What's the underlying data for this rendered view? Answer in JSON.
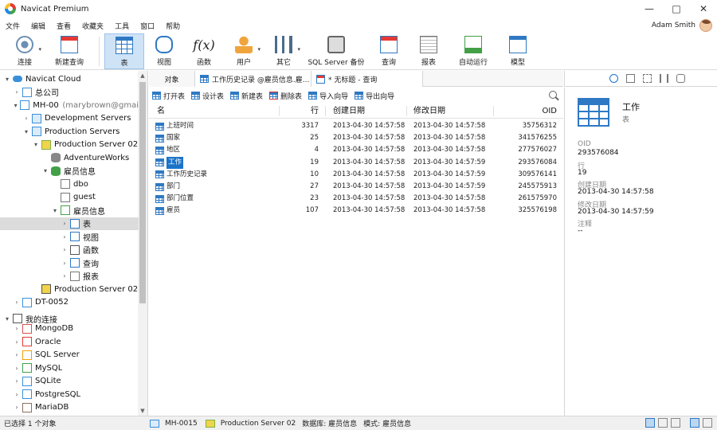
{
  "window": {
    "title": "Navicat Premium"
  },
  "menu": [
    "文件",
    "编辑",
    "查看",
    "收藏夹",
    "工具",
    "窗口",
    "帮助"
  ],
  "user": {
    "name": "Adam Smith"
  },
  "toolbar": [
    {
      "label": "连接",
      "icon": "plug-icon",
      "caret": true
    },
    {
      "label": "新建查询",
      "icon": "new-query-icon"
    },
    {
      "label": "表",
      "icon": "table-icon",
      "active": true
    },
    {
      "label": "视图",
      "icon": "view-icon"
    },
    {
      "label": "函数",
      "icon": "function-icon"
    },
    {
      "label": "用户",
      "icon": "user-icon",
      "caret": true
    },
    {
      "label": "其它",
      "icon": "tools-icon",
      "caret": true
    },
    {
      "label": "SQL Server 备份",
      "icon": "backup-icon"
    },
    {
      "label": "查询",
      "icon": "query-icon"
    },
    {
      "label": "报表",
      "icon": "report-icon"
    },
    {
      "label": "自动运行",
      "icon": "automation-icon"
    },
    {
      "label": "模型",
      "icon": "model-icon"
    }
  ],
  "tree": [
    {
      "label": "Navicat Cloud",
      "level": 0,
      "toggle": "▾",
      "icon": "cloud-icon",
      "color": "#3b8fd9"
    },
    {
      "label": "总公司",
      "level": 1,
      "toggle": "›",
      "icon": "project-icon",
      "color": "#3b8fd9"
    },
    {
      "label": "MH-0015",
      "muted": "(marybrown@gmai",
      "level": 1,
      "toggle": "▾",
      "icon": "server-group-icon",
      "color": "#3b8fd9"
    },
    {
      "label": "Development Servers",
      "level": 2,
      "toggle": "›",
      "icon": "folder-icon",
      "color": "#3b8fd9"
    },
    {
      "label": "Production Servers",
      "level": 2,
      "toggle": "▾",
      "icon": "folder-icon",
      "color": "#3b8fd9"
    },
    {
      "label": "Production Server 02",
      "level": 3,
      "toggle": "▾",
      "icon": "sqlserver-conn-icon",
      "color": "#7cb342"
    },
    {
      "label": "AdventureWorks",
      "level": 4,
      "toggle": "",
      "icon": "database-icon",
      "color": "#888888"
    },
    {
      "label": "雇员信息",
      "level": 4,
      "toggle": "▾",
      "icon": "database-icon",
      "color": "#43a047"
    },
    {
      "label": "dbo",
      "level": 5,
      "toggle": "",
      "icon": "schema-icon",
      "color": "#777777"
    },
    {
      "label": "guest",
      "level": 5,
      "toggle": "",
      "icon": "schema-icon",
      "color": "#777777"
    },
    {
      "label": "雇员信息",
      "level": 5,
      "toggle": "▾",
      "icon": "schema-icon",
      "color": "#43a047"
    },
    {
      "label": "表",
      "level": 6,
      "toggle": "›",
      "icon": "table-icon",
      "color": "#2f79c4",
      "selected": true
    },
    {
      "label": "视图",
      "level": 6,
      "toggle": "›",
      "icon": "view-icon",
      "color": "#2f79c4"
    },
    {
      "label": "函数",
      "level": 6,
      "toggle": "›",
      "icon": "function-icon",
      "color": "#555555"
    },
    {
      "label": "查询",
      "level": 6,
      "toggle": "›",
      "icon": "query-icon",
      "color": "#2f79c4"
    },
    {
      "label": "报表",
      "level": 6,
      "toggle": "›",
      "icon": "report-icon",
      "color": "#777777"
    },
    {
      "label": "Production Server 02",
      "level": 3,
      "toggle": "",
      "icon": "sqlserver-conn-icon",
      "color": "#555555"
    },
    {
      "label": "DT-0052",
      "level": 1,
      "toggle": "›",
      "icon": "server-group-icon",
      "color": "#3b8fd9"
    },
    {
      "label": "我的连接",
      "level": 0,
      "toggle": "▾",
      "icon": "connections-icon",
      "color": "#555555"
    },
    {
      "label": "MongoDB",
      "level": 1,
      "toggle": "›",
      "icon": "mongodb-icon",
      "color": "#d9534f"
    },
    {
      "label": "Oracle",
      "level": 1,
      "toggle": "›",
      "icon": "oracle-icon",
      "color": "#e53935"
    },
    {
      "label": "SQL Server",
      "level": 1,
      "toggle": "›",
      "icon": "sqlserver-icon",
      "color": "#f0a30a"
    },
    {
      "label": "MySQL",
      "level": 1,
      "toggle": "›",
      "icon": "mysql-icon",
      "color": "#43a047"
    },
    {
      "label": "SQLite",
      "level": 1,
      "toggle": "›",
      "icon": "sqlite-icon",
      "color": "#3b8fd9"
    },
    {
      "label": "PostgreSQL",
      "level": 1,
      "toggle": "›",
      "icon": "postgresql-icon",
      "color": "#3b8fd9"
    },
    {
      "label": "MariaDB",
      "level": 1,
      "toggle": "›",
      "icon": "mariadb-icon",
      "color": "#8d6e63"
    }
  ],
  "tabs": [
    {
      "label": "对象"
    },
    {
      "label": "工作历史记录 @雇员信息.雇..."
    },
    {
      "label": "* 无标题 - 查询"
    }
  ],
  "object_toolbar": [
    "打开表",
    "设计表",
    "新建表",
    "删除表",
    "导入向导",
    "导出向导"
  ],
  "table": {
    "columns": [
      "名",
      "行",
      "创建日期",
      "修改日期",
      "OID"
    ],
    "rows": [
      {
        "name": "上班时间",
        "rows": "3317",
        "created": "2013-04-30 14:57:58",
        "modified": "2013-04-30 14:57:58",
        "oid": "35756312"
      },
      {
        "name": "国家",
        "rows": "25",
        "created": "2013-04-30 14:57:58",
        "modified": "2013-04-30 14:57:58",
        "oid": "341576255"
      },
      {
        "name": "地区",
        "rows": "4",
        "created": "2013-04-30 14:57:58",
        "modified": "2013-04-30 14:57:58",
        "oid": "277576027"
      },
      {
        "name": "工作",
        "rows": "19",
        "created": "2013-04-30 14:57:58",
        "modified": "2013-04-30 14:57:59",
        "oid": "293576084",
        "selected": true
      },
      {
        "name": "工作历史记录",
        "rows": "10",
        "created": "2013-04-30 14:57:58",
        "modified": "2013-04-30 14:57:59",
        "oid": "309576141"
      },
      {
        "name": "部门",
        "rows": "27",
        "created": "2013-04-30 14:57:58",
        "modified": "2013-04-30 14:57:59",
        "oid": "245575913"
      },
      {
        "name": "部门位置",
        "rows": "23",
        "created": "2013-04-30 14:57:58",
        "modified": "2013-04-30 14:57:58",
        "oid": "261575970"
      },
      {
        "name": "雇员",
        "rows": "107",
        "created": "2013-04-30 14:57:58",
        "modified": "2013-04-30 14:57:58",
        "oid": "325576198"
      }
    ]
  },
  "info": {
    "name": "工作",
    "type": "表",
    "fields": [
      {
        "label": "OID",
        "value": "293576084"
      },
      {
        "label": "行",
        "value": "19"
      },
      {
        "label": "创建日期",
        "value": "2013-04-30 14:57:58"
      },
      {
        "label": "修改日期",
        "value": "2013-04-30 14:57:59"
      },
      {
        "label": "注释",
        "value": "--"
      }
    ]
  },
  "status": {
    "selection": "已选择 1 个对象",
    "connection": "MH-0015",
    "server": "Production Server 02",
    "database": "数据库: 雇员信息",
    "schema": "模式: 雇员信息"
  }
}
